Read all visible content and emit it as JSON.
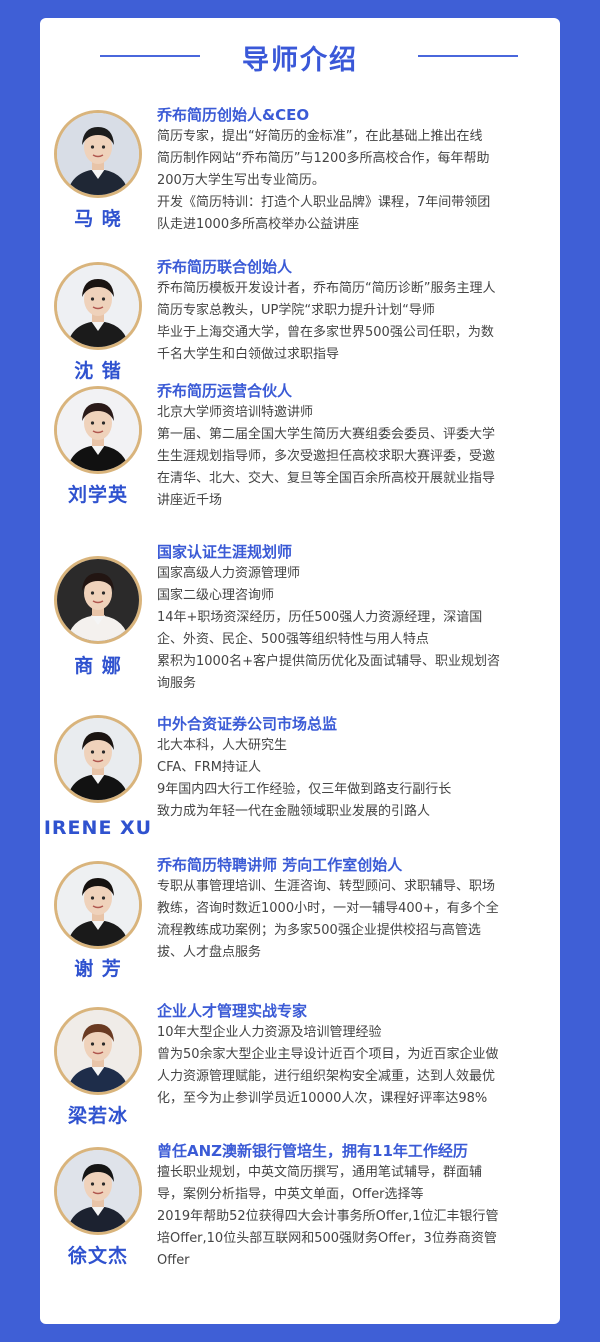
{
  "header": {
    "title": "导师介绍"
  },
  "mentors": [
    {
      "name": "马 晓",
      "role": "乔布简历创始人&CEO",
      "lines": [
        "简历专家，提出“好简历的金标准”，在此基础上推出在线",
        "简历制作网站“乔布简历”与1200多所高校合作，每年帮助",
        "200万大学生写出专业简历。",
        "开发《简历特训：打造个人职业品牌》课程，7年间带领团",
        "队走进1000多所高校举办公益讲座"
      ],
      "portrait": {
        "hair": "#1c1c1c",
        "outfit": "#1f2735",
        "bg": "#d8dde6"
      }
    },
    {
      "name": "沈 锴",
      "role": "乔布简历联合创始人",
      "lines": [
        "乔布简历模板开发设计者，乔布简历“简历诊断”服务主理人",
        "简历专家总教头，UP学院“求职力提升计划“导师",
        "毕业于上海交通大学，曾在多家世界500强公司任职，为数",
        "千名大学生和白领做过求职指导"
      ],
      "portrait": {
        "hair": "#1a1412",
        "outfit": "#1b1b1b",
        "bg": "#eef0f3"
      }
    },
    {
      "name": "刘学英",
      "role": "乔布简历运营合伙人",
      "lines": [
        "北京大学师资培训特邀讲师",
        "第一届、第二届全国大学生简历大赛组委会委员、评委大学",
        "生生涯规划指导师，多次受邀担任高校求职大赛评委，受邀",
        "在清华、北大、交大、复旦等全国百余所高校开展就业指导",
        "讲座近千场"
      ],
      "portrait": {
        "hair": "#2a1a18",
        "outfit": "#111111",
        "bg": "#f2f2f4"
      }
    },
    {
      "name": "商 娜",
      "role": "国家认证生涯规划师",
      "lines": [
        "国家高级人力资源管理师",
        "国家二级心理咨询师",
        "14年+职场资深经历，历任500强人力资源经理，深谙国",
        "企、外资、民企、500强等组织特性与用人特点",
        "累积为1000名+客户提供简历优化及面试辅导、职业规划咨",
        "询服务"
      ],
      "portrait": {
        "hair": "#221512",
        "outfit": "#f4f1ee",
        "bg": "#2b2a2a"
      }
    },
    {
      "name": "IRENE XU",
      "role": "中外合资证券公司市场总监",
      "lines": [
        "北大本科，人大研究生",
        "CFA、FRM持证人",
        "9年国内四大行工作经验，仅三年做到路支行副行长",
        "致力成为年轻一代在金融领域职业发展的引路人"
      ],
      "portrait": {
        "hair": "#1a1411",
        "outfit": "#121212",
        "bg": "#e9ecef"
      }
    },
    {
      "name": "谢 芳",
      "role": "乔布简历特聘讲师  芳向工作室创始人",
      "lines": [
        "专职从事管理培训、生涯咨询、转型顾问、求职辅导、职场",
        "教练，咨询时数近1000小时，一对一辅导400+，有多个全",
        "流程教练成功案例；为多家500强企业提供校招与高管选",
        "拔、人才盘点服务"
      ],
      "portrait": {
        "hair": "#161210",
        "outfit": "#1a1a1a",
        "bg": "#eef0f2"
      }
    },
    {
      "name": "梁若冰",
      "role": "企业人才管理实战专家",
      "lines": [
        "10年大型企业人力资源及培训管理经验",
        "曾为50余家大型企业主导设计近百个项目，为近百家企业做",
        "人力资源管理赋能，进行组织架构安全减重，达到人效最优",
        "化，至今为止参训学员近10000人次，课程好评率达98%"
      ],
      "portrait": {
        "hair": "#6a3a22",
        "outfit": "#1e2d4a",
        "bg": "#f0ece8"
      }
    },
    {
      "name": "徐文杰",
      "role": "曾任ANZ澳新银行管培生，拥有11年工作经历",
      "lines": [
        "擅长职业规划，中英文简历撰写，通用笔试辅导，群面辅",
        "导，案例分析指导，中英文单面，Offer选择等",
        "2019年帮助52位获得四大会计事务所Offer,1位汇丰银行管",
        "培Offer,10位头部互联网和500强财务Offer，3位券商资管",
        "Offer"
      ],
      "portrait": {
        "hair": "#151515",
        "outfit": "#1c2230",
        "bg": "#dfe3ea"
      }
    }
  ]
}
